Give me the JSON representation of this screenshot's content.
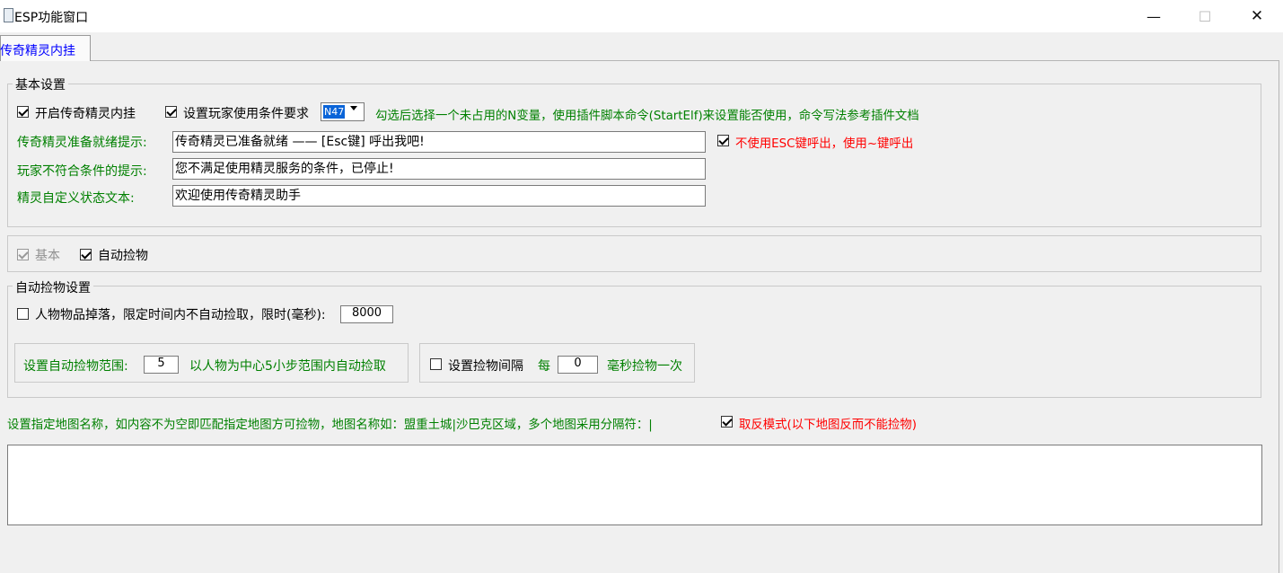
{
  "window": {
    "title": "ESP功能窗口",
    "minimize_glyph": "—",
    "maximize_glyph": "☐",
    "close_glyph": "✕"
  },
  "tab": {
    "label": "传奇精灵内挂"
  },
  "basic_settings": {
    "legend": "基本设置",
    "enable_label": "开启传奇精灵内挂",
    "enable_checked": true,
    "condition_label": "设置玩家使用条件要求",
    "condition_checked": true,
    "variable_selected": "N47",
    "condition_hint": "勾选后选择一个未占用的N变量，使用插件脚本命令(StartElf)来设置能否使用，命令写法参考插件文档",
    "ready_prompt_label": "传奇精灵准备就绪提示:",
    "ready_prompt_value": "传奇精灵已准备就绪 —— [Esc键] 呼出我吧!",
    "no_esc_label": "不使用ESC键呼出，使用~键呼出",
    "no_esc_checked": true,
    "not_qualified_label": "玩家不符合条件的提示:",
    "not_qualified_value": "您不满足使用精灵服务的条件，已停止!",
    "custom_status_label": "精灵自定义状态文本:",
    "custom_status_value": "欢迎使用传奇精灵助手"
  },
  "feature_toggles": {
    "basic_label": "基本",
    "basic_checked": true,
    "basic_disabled": true,
    "auto_pickup_label": "自动捡物",
    "auto_pickup_checked": true
  },
  "auto_pickup_settings": {
    "legend": "自动捡物设置",
    "drop_limit_label": "人物物品掉落，限定时间内不自动捡取，限时(毫秒):",
    "drop_limit_checked": false,
    "drop_limit_value": "8000",
    "range_label": "设置自动捡物范围:",
    "range_value": "5",
    "range_hint": "以人物为中心5小步范围内自动捡取",
    "interval_label": "设置捡物间隔",
    "interval_checked": false,
    "interval_prefix": "每",
    "interval_value": "0",
    "interval_suffix": "毫秒捡物一次"
  },
  "map_filter": {
    "label": "设置指定地图名称，如内容不为空即匹配指定地图方可捡物，地图名称如：盟重土城|沙巴克区域，多个地图采用分隔符：|",
    "invert_label": "取反模式(以下地图反而不能捡物)",
    "invert_checked": true,
    "text_value": ""
  },
  "colors": {
    "green_text": "#008000",
    "red_text": "#ff0000",
    "tab_text": "#0000ff",
    "selection": "#0a64d8"
  }
}
